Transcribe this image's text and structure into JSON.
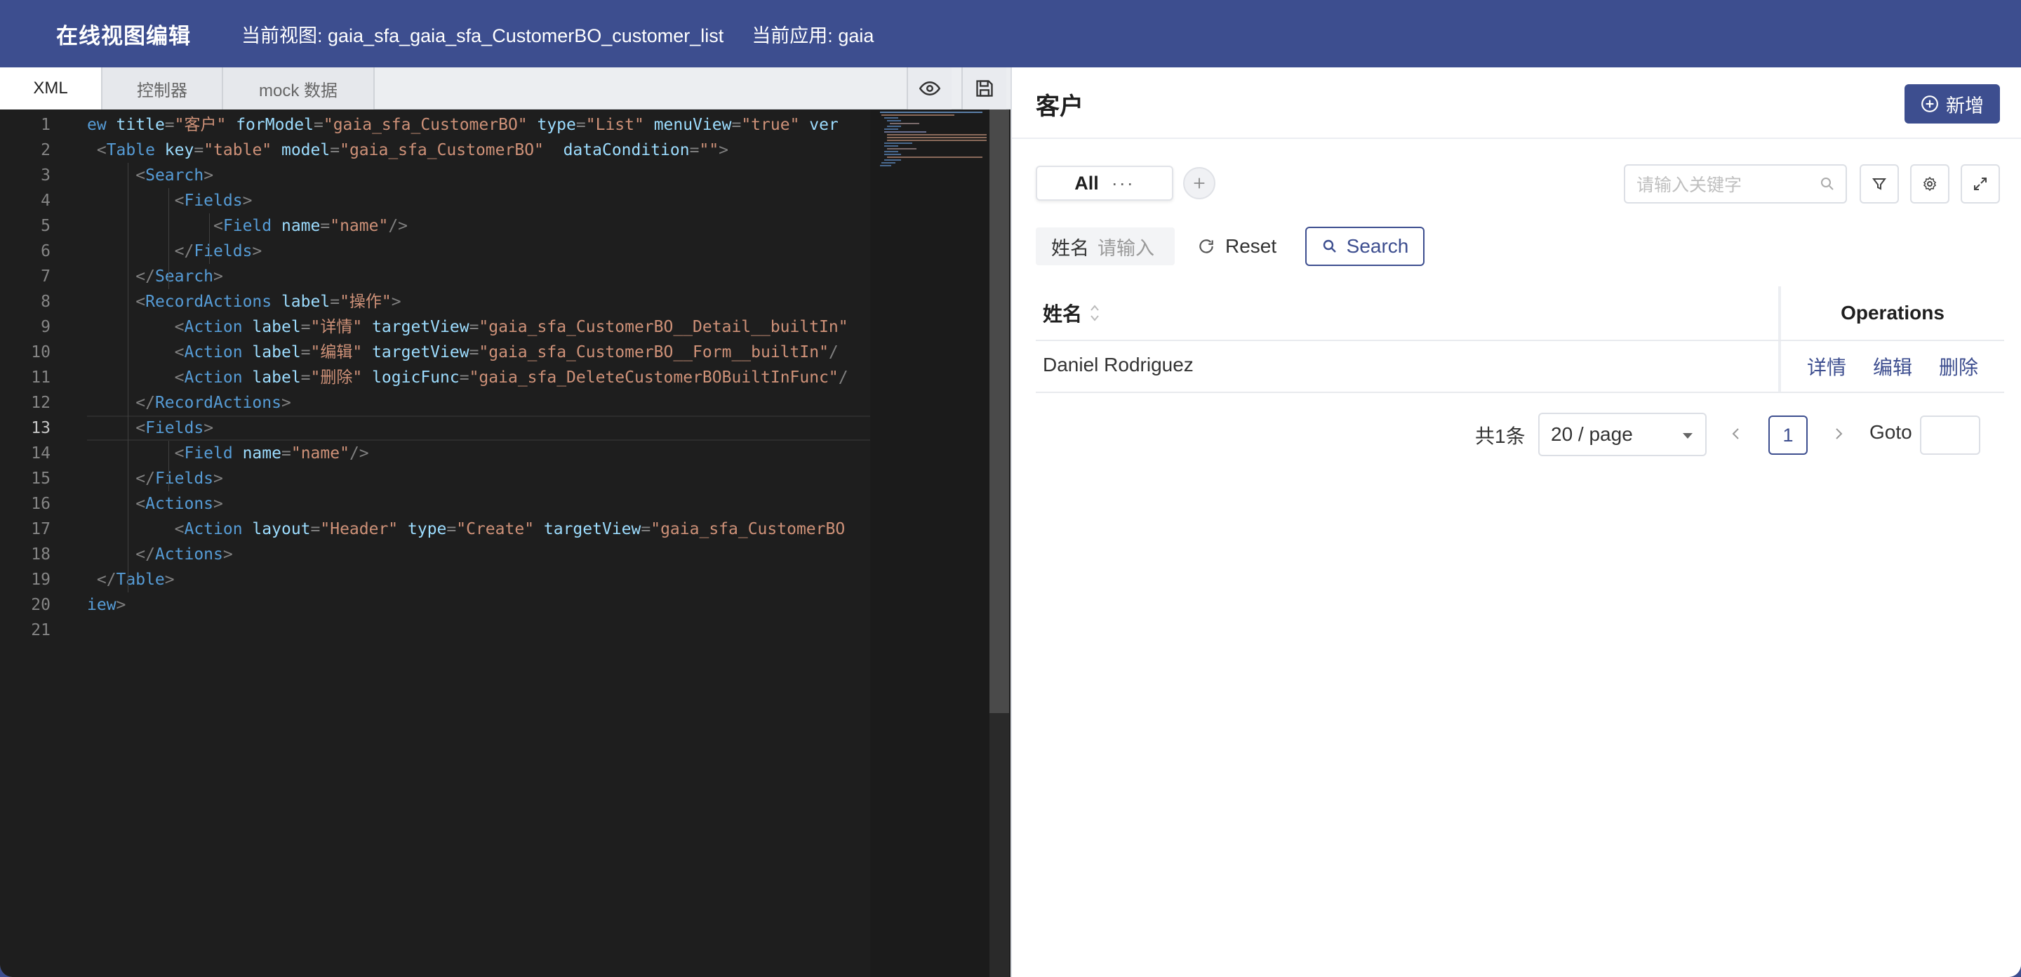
{
  "header": {
    "title": "在线视图编辑",
    "current_view": "当前视图: gaia_sfa_gaia_sfa_CustomerBO_customer_list",
    "current_app": "当前应用: gaia"
  },
  "editor": {
    "tabs": [
      {
        "label": "XML",
        "active": true
      },
      {
        "label": "控制器",
        "active": false
      },
      {
        "label": "mock 数据",
        "active": false
      }
    ],
    "tools": [
      {
        "icon": "eye-icon"
      },
      {
        "icon": "save-icon"
      }
    ],
    "current_line": 13,
    "lines": [
      [
        [
          "t-tag",
          "ew"
        ],
        [
          "t-attr",
          " title"
        ],
        [
          "t-br",
          "="
        ],
        [
          "t-str",
          "\"客户\""
        ],
        [
          "t-attr",
          " forModel"
        ],
        [
          "t-br",
          "="
        ],
        [
          "t-str",
          "\"gaia_sfa_CustomerBO\""
        ],
        [
          "t-attr",
          " type"
        ],
        [
          "t-br",
          "="
        ],
        [
          "t-str",
          "\"List\""
        ],
        [
          "t-attr",
          " menuView"
        ],
        [
          "t-br",
          "="
        ],
        [
          "t-str",
          "\"true\""
        ],
        [
          "t-attr",
          " ver"
        ]
      ],
      [
        [
          "t-br",
          " <"
        ],
        [
          "t-tag",
          "Table"
        ],
        [
          "t-attr",
          " key"
        ],
        [
          "t-br",
          "="
        ],
        [
          "t-str",
          "\"table\""
        ],
        [
          "t-attr",
          " model"
        ],
        [
          "t-br",
          "="
        ],
        [
          "t-str",
          "\"gaia_sfa_CustomerBO\""
        ],
        [
          "t-attr",
          "  dataCondition"
        ],
        [
          "t-br",
          "="
        ],
        [
          "t-str",
          "\"\""
        ],
        [
          "t-br",
          ">"
        ]
      ],
      [
        [
          "t-br",
          "     <"
        ],
        [
          "t-tag",
          "Search"
        ],
        [
          "t-br",
          ">"
        ]
      ],
      [
        [
          "t-br",
          "         <"
        ],
        [
          "t-tag",
          "Fields"
        ],
        [
          "t-br",
          ">"
        ]
      ],
      [
        [
          "t-br",
          "             <"
        ],
        [
          "t-tag",
          "Field"
        ],
        [
          "t-attr",
          " name"
        ],
        [
          "t-br",
          "="
        ],
        [
          "t-str",
          "\"name\""
        ],
        [
          "t-br",
          "/>"
        ]
      ],
      [
        [
          "t-br",
          "         </"
        ],
        [
          "t-tag",
          "Fields"
        ],
        [
          "t-br",
          ">"
        ]
      ],
      [
        [
          "t-br",
          "     </"
        ],
        [
          "t-tag",
          "Search"
        ],
        [
          "t-br",
          ">"
        ]
      ],
      [
        [
          "t-br",
          "     <"
        ],
        [
          "t-tag",
          "RecordActions"
        ],
        [
          "t-attr",
          " label"
        ],
        [
          "t-br",
          "="
        ],
        [
          "t-str",
          "\"操作\""
        ],
        [
          "t-br",
          ">"
        ]
      ],
      [
        [
          "t-br",
          "         <"
        ],
        [
          "t-tag",
          "Action"
        ],
        [
          "t-attr",
          " label"
        ],
        [
          "t-br",
          "="
        ],
        [
          "t-str",
          "\"详情\""
        ],
        [
          "t-attr",
          " targetView"
        ],
        [
          "t-br",
          "="
        ],
        [
          "t-str",
          "\"gaia_sfa_CustomerBO__Detail__builtIn\""
        ]
      ],
      [
        [
          "t-br",
          "         <"
        ],
        [
          "t-tag",
          "Action"
        ],
        [
          "t-attr",
          " label"
        ],
        [
          "t-br",
          "="
        ],
        [
          "t-str",
          "\"编辑\""
        ],
        [
          "t-attr",
          " targetView"
        ],
        [
          "t-br",
          "="
        ],
        [
          "t-str",
          "\"gaia_sfa_CustomerBO__Form__builtIn\""
        ],
        [
          "t-br",
          "/"
        ]
      ],
      [
        [
          "t-br",
          "         <"
        ],
        [
          "t-tag",
          "Action"
        ],
        [
          "t-attr",
          " label"
        ],
        [
          "t-br",
          "="
        ],
        [
          "t-str",
          "\"删除\""
        ],
        [
          "t-attr",
          " logicFunc"
        ],
        [
          "t-br",
          "="
        ],
        [
          "t-str",
          "\"gaia_sfa_DeleteCustomerBOBuiltInFunc\""
        ],
        [
          "t-br",
          "/"
        ]
      ],
      [
        [
          "t-br",
          "     </"
        ],
        [
          "t-tag",
          "RecordActions"
        ],
        [
          "t-br",
          ">"
        ]
      ],
      [
        [
          "t-br",
          "     <"
        ],
        [
          "t-tag",
          "Fields"
        ],
        [
          "t-br",
          ">"
        ]
      ],
      [
        [
          "t-br",
          "         <"
        ],
        [
          "t-tag",
          "Field"
        ],
        [
          "t-attr",
          " name"
        ],
        [
          "t-br",
          "="
        ],
        [
          "t-str",
          "\"name\""
        ],
        [
          "t-br",
          "/>"
        ]
      ],
      [
        [
          "t-br",
          "     </"
        ],
        [
          "t-tag",
          "Fields"
        ],
        [
          "t-br",
          ">"
        ]
      ],
      [
        [
          "t-br",
          "     <"
        ],
        [
          "t-tag",
          "Actions"
        ],
        [
          "t-br",
          ">"
        ]
      ],
      [
        [
          "t-br",
          "         <"
        ],
        [
          "t-tag",
          "Action"
        ],
        [
          "t-attr",
          " layout"
        ],
        [
          "t-br",
          "="
        ],
        [
          "t-str",
          "\"Header\""
        ],
        [
          "t-attr",
          " type"
        ],
        [
          "t-br",
          "="
        ],
        [
          "t-str",
          "\"Create\""
        ],
        [
          "t-attr",
          " targetView"
        ],
        [
          "t-br",
          "="
        ],
        [
          "t-str",
          "\"gaia_sfa_CustomerBO"
        ]
      ],
      [
        [
          "t-br",
          "     </"
        ],
        [
          "t-tag",
          "Actions"
        ],
        [
          "t-br",
          ">"
        ]
      ],
      [
        [
          "t-br",
          " </"
        ],
        [
          "t-tag",
          "Table"
        ],
        [
          "t-br",
          ">"
        ]
      ],
      [
        [
          "t-tag",
          "iew"
        ],
        [
          "t-br",
          ">"
        ]
      ],
      []
    ]
  },
  "preview": {
    "title": "客户",
    "add_button": "新增",
    "view_tab": "All",
    "view_tab_more": "···",
    "keyword_placeholder": "请输入关键字",
    "filter": {
      "label": "姓名",
      "placeholder": "请输入"
    },
    "reset_label": "Reset",
    "search_label": "Search",
    "table": {
      "columns": [
        "姓名",
        "Operations"
      ],
      "rows": [
        {
          "name": "Daniel Rodriguez",
          "actions": [
            "详情",
            "编辑",
            "删除"
          ]
        }
      ]
    },
    "pagination": {
      "total": "共1条",
      "page_size": "20 / page",
      "current_page": "1",
      "goto_label": "Goto"
    }
  },
  "colors": {
    "primary": "#3d4e8f",
    "editor_bg": "#1e1e1e"
  }
}
